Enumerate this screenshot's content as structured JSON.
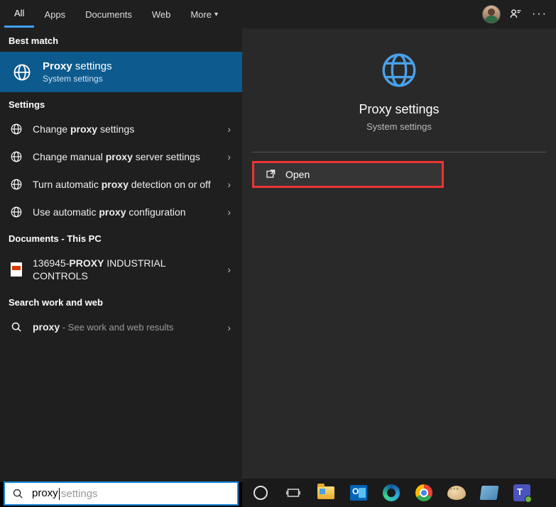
{
  "tabs": {
    "all": "All",
    "apps": "Apps",
    "documents": "Documents",
    "web": "Web",
    "more": "More"
  },
  "sections": {
    "best_match": "Best match",
    "settings": "Settings",
    "documents": "Documents - This PC",
    "work_web": "Search work and web"
  },
  "best_match": {
    "title_bold": "Proxy",
    "title_rest": " settings",
    "subtitle": "System settings"
  },
  "settings_items": [
    {
      "pre": "Change ",
      "bold": "proxy",
      "post": " settings"
    },
    {
      "pre": "Change manual ",
      "bold": "proxy",
      "post": " server settings"
    },
    {
      "pre": "Turn automatic ",
      "bold": "proxy",
      "post": " detection on or off"
    },
    {
      "pre": "Use automatic ",
      "bold": "proxy",
      "post": " configuration"
    }
  ],
  "documents_items": [
    {
      "pre": "136945-",
      "bold": "PROXY",
      "post": " INDUSTRIAL CONTROLS"
    }
  ],
  "work_web_items": [
    {
      "bold": "proxy",
      "sub": " - See work and web results"
    }
  ],
  "preview": {
    "title": "Proxy settings",
    "subtitle": "System settings",
    "open": "Open"
  },
  "search": {
    "typed": "proxy",
    "ghost_suffix": " settings"
  }
}
